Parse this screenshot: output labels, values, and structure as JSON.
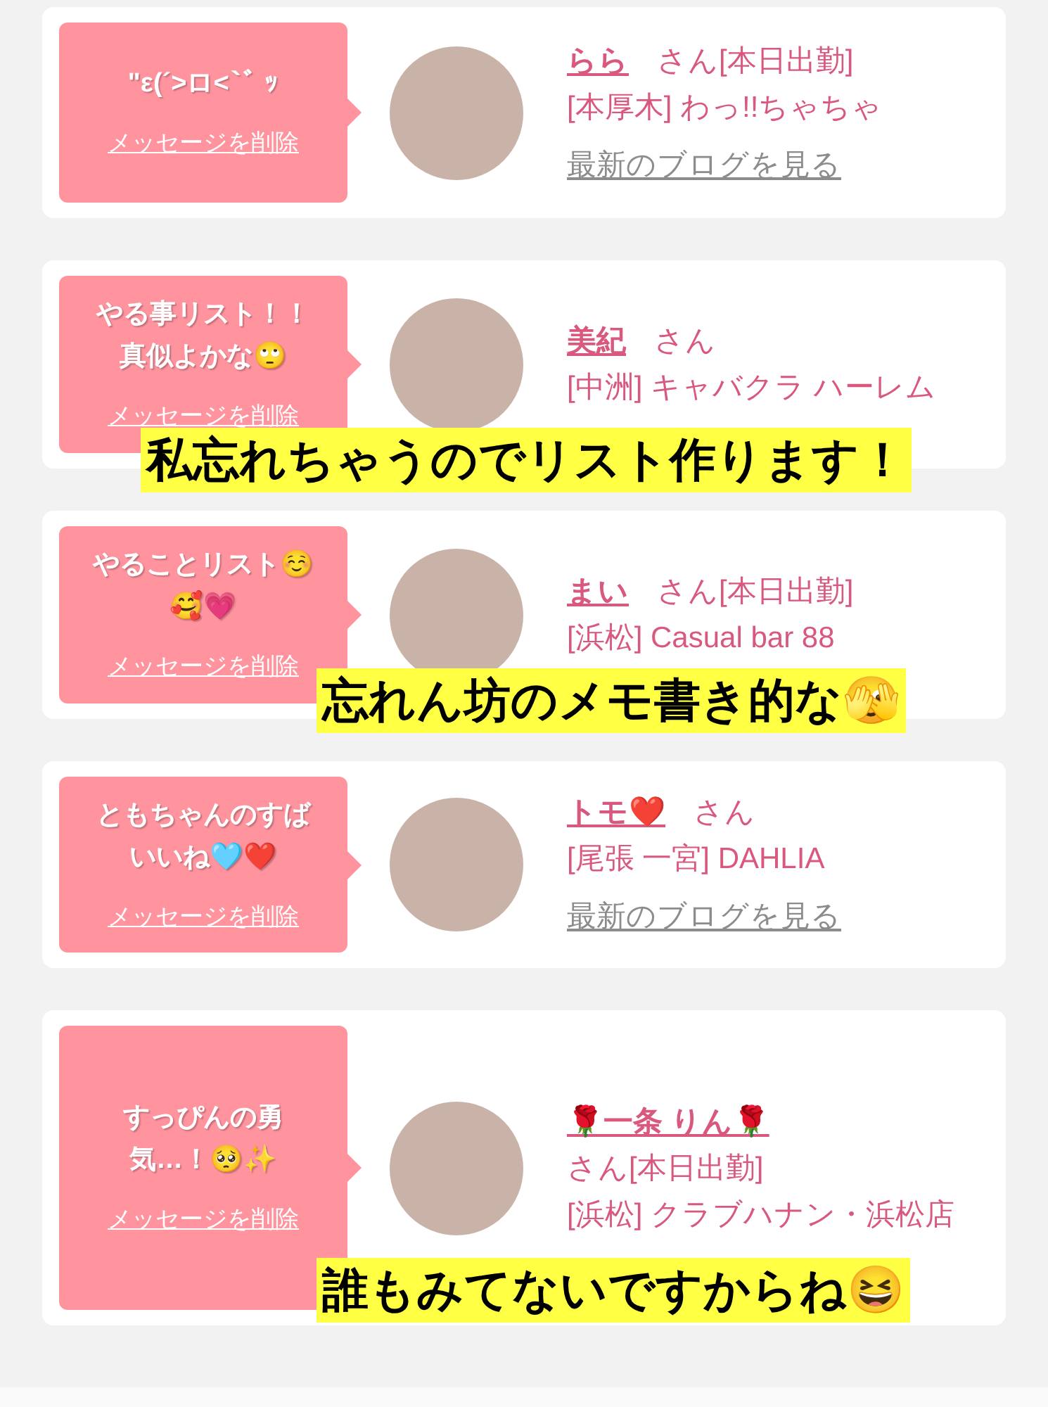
{
  "cards": [
    {
      "message": "\"ε(´>ロ<`ﾞ ｯ",
      "delete_label": "メッセージを削除",
      "name": "らら",
      "suffix": "さん[本日出勤]",
      "shop": "[本厚木] わっ!!ちゃちゃ",
      "blog_link": "最新のブログを見る"
    },
    {
      "message": "やる事リスト！！真似よかな🙄",
      "delete_label": "メッセージを削除",
      "name": "美紀",
      "suffix": "さん",
      "shop": "[中洲] キャバクラ ハーレム",
      "caption": "私忘れちゃうのでリスト作ります！"
    },
    {
      "message": "やることリスト☺️🥰💗",
      "delete_label": "メッセージを削除",
      "name": "まい",
      "suffix": "さん[本日出勤]",
      "shop": "[浜松] Casual bar 88",
      "caption": "忘れん坊のメモ書き的な🫣"
    },
    {
      "message": "ともちゃんのすばいいね🩵❤️",
      "delete_label": "メッセージを削除",
      "name": "トモ❤️",
      "suffix": "さん",
      "shop": "[尾張 一宮] DAHLIA",
      "blog_link": "最新のブログを見る"
    },
    {
      "message": "すっぴんの勇気…！🥺✨",
      "delete_label": "メッセージを削除",
      "name": "🌹一条 りん🌹",
      "suffix": "さん[本日出勤]",
      "shop": "[浜松] クラブハナン・浜松店",
      "caption": "誰もみてないですからね😆"
    }
  ]
}
